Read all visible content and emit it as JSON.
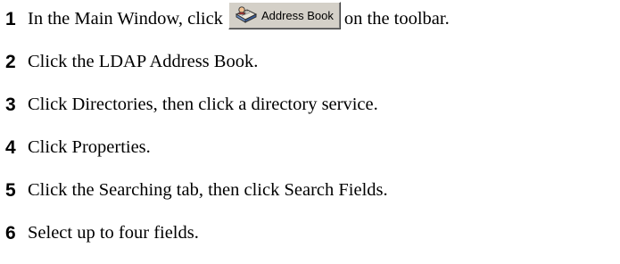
{
  "steps": [
    {
      "number": "1",
      "text_before": "In the Main Window, click",
      "button": {
        "label": "Address Book",
        "icon": "address-book-icon"
      },
      "text_after": "on the toolbar."
    },
    {
      "number": "2",
      "text": "Click the LDAP Address Book."
    },
    {
      "number": "3",
      "text": "Click Directories, then click a directory service."
    },
    {
      "number": "4",
      "text": "Click Properties."
    },
    {
      "number": "5",
      "text": "Click the Searching tab, then click Search Fields."
    },
    {
      "number": "6",
      "text": "Select up to four fields."
    }
  ]
}
